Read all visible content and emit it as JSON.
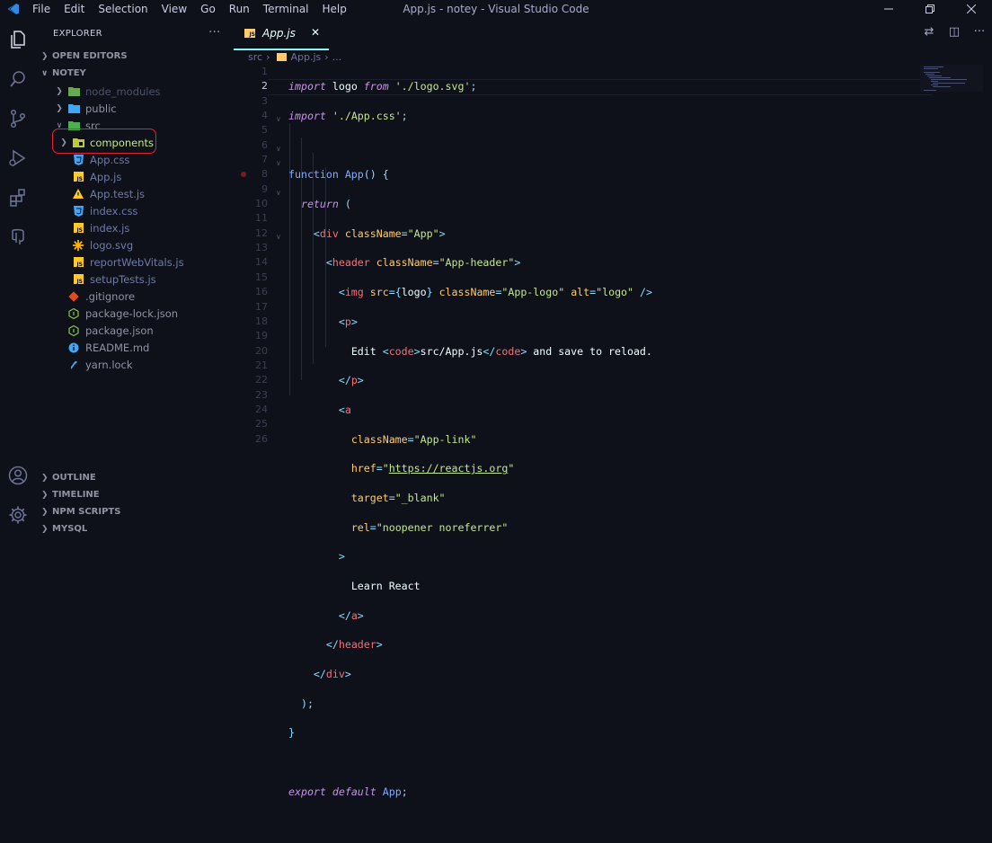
{
  "window": {
    "title": "App.js - notey - Visual Studio Code",
    "menu": [
      "File",
      "Edit",
      "Selection",
      "View",
      "Go",
      "Run",
      "Terminal",
      "Help"
    ]
  },
  "sidebar": {
    "title": "EXPLORER",
    "more": "···",
    "open_editors": "OPEN EDITORS",
    "project": "NOTEY",
    "tree": [
      {
        "label": "node_modules",
        "icon": "folder-node-icon",
        "depth": 1,
        "dim": true
      },
      {
        "label": "public",
        "icon": "folder-public-icon",
        "depth": 1
      },
      {
        "label": "src",
        "icon": "folder-src-icon",
        "depth": 1,
        "open": true
      },
      {
        "label": "components",
        "icon": "folder-components-icon",
        "depth": 2,
        "highlight": true
      },
      {
        "label": "App.css",
        "icon": "css-icon",
        "depth": 2
      },
      {
        "label": "App.js",
        "icon": "js-icon",
        "depth": 2
      },
      {
        "label": "App.test.js",
        "icon": "test-icon",
        "depth": 2
      },
      {
        "label": "index.css",
        "icon": "css-icon",
        "depth": 2
      },
      {
        "label": "index.js",
        "icon": "js-icon",
        "depth": 2
      },
      {
        "label": "logo.svg",
        "icon": "svg-icon",
        "depth": 2
      },
      {
        "label": "reportWebVitals.js",
        "icon": "js-icon",
        "depth": 2
      },
      {
        "label": "setupTests.js",
        "icon": "js-icon",
        "depth": 2
      },
      {
        "label": ".gitignore",
        "icon": "git-icon",
        "depth": 1
      },
      {
        "label": "package-lock.json",
        "icon": "nodejs-icon",
        "depth": 1
      },
      {
        "label": "package.json",
        "icon": "nodejs-icon",
        "depth": 1
      },
      {
        "label": "README.md",
        "icon": "info-icon",
        "depth": 1
      },
      {
        "label": "yarn.lock",
        "icon": "yarn-icon",
        "depth": 1
      }
    ],
    "sections": [
      "OUTLINE",
      "TIMELINE",
      "NPM SCRIPTS",
      "MYSQL"
    ]
  },
  "editor": {
    "tab_label": "App.js",
    "breadcrumb": [
      "src",
      "App.js",
      "..."
    ],
    "current_line": 2,
    "line_count": 26
  },
  "colors": {
    "background": "#0f111a",
    "accent": "#84ffff",
    "annotation": "#e0242d"
  }
}
